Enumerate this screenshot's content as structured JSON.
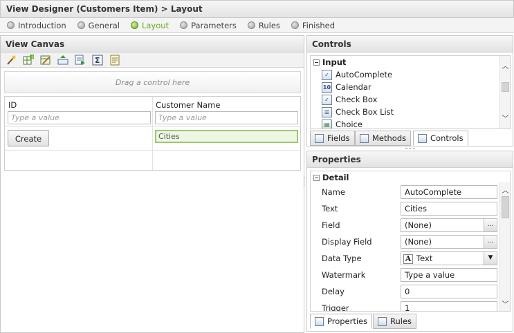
{
  "window": {
    "title": "View Designer (Customers Item) > Layout"
  },
  "steps": [
    {
      "label": "Introduction",
      "active": false
    },
    {
      "label": "General",
      "active": false
    },
    {
      "label": "Layout",
      "active": true
    },
    {
      "label": "Parameters",
      "active": false
    },
    {
      "label": "Rules",
      "active": false
    },
    {
      "label": "Finished",
      "active": false
    }
  ],
  "canvas": {
    "title": "View Canvas",
    "toolbar_icons": [
      "magic-wand-icon",
      "add-row-icon",
      "edit-table-icon",
      "insert-row-icon",
      "export-icon",
      "sigma-icon",
      "notes-icon"
    ],
    "drag_hint": "Drag a control here",
    "id_label": "ID",
    "id_placeholder": "Type a value",
    "name_label": "Customer Name",
    "name_placeholder": "Type a value",
    "create_button": "Create",
    "cities_value": "Cities"
  },
  "controls": {
    "title": "Controls",
    "group": "Input",
    "items": [
      {
        "label": "AutoComplete",
        "icon": "autocomplete-icon"
      },
      {
        "label": "Calendar",
        "icon": "calendar-icon"
      },
      {
        "label": "Check Box",
        "icon": "checkbox-icon"
      },
      {
        "label": "Check Box List",
        "icon": "checkbox-list-icon"
      },
      {
        "label": "Choice",
        "icon": "choice-icon"
      }
    ],
    "calendar_icon_text": "10",
    "tabs": [
      {
        "label": "Fields",
        "selected": false
      },
      {
        "label": "Methods",
        "selected": false
      },
      {
        "label": "Controls",
        "selected": true
      }
    ]
  },
  "properties": {
    "title": "Properties",
    "group": "Detail",
    "rows": [
      {
        "key": "Name",
        "value": "AutoComplete"
      },
      {
        "key": "Text",
        "value": "Cities"
      },
      {
        "key": "Field",
        "value": "(None)"
      },
      {
        "key": "Display Field",
        "value": "(None)"
      },
      {
        "key": "Data Type",
        "value": "Text"
      },
      {
        "key": "Watermark",
        "value": "Type a value"
      },
      {
        "key": "Delay",
        "value": "0"
      },
      {
        "key": "Trigger",
        "value": "1"
      }
    ],
    "ellipsis": "...",
    "data_type_glyph": "A",
    "tabs": [
      {
        "label": "Properties",
        "selected": true
      },
      {
        "label": "Rules",
        "selected": false
      }
    ]
  },
  "colors": {
    "accent": "#6aa524",
    "highlight_border": "#9dc870",
    "highlight_bg": "#eef7e4"
  }
}
